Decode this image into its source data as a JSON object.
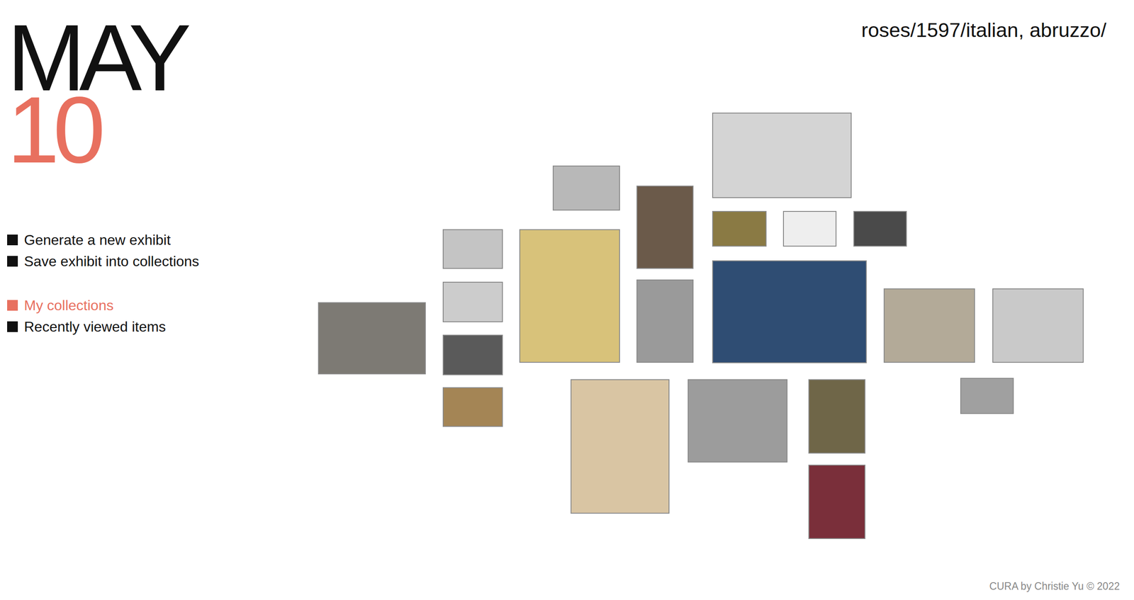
{
  "date": {
    "month": "MAY",
    "day": "10"
  },
  "menu": {
    "groups": [
      {
        "items": [
          {
            "label": "Generate a new exhibit",
            "selected": false
          },
          {
            "label": "Save exhibit into collections",
            "selected": false
          }
        ]
      },
      {
        "items": [
          {
            "label": "My collections",
            "selected": true
          },
          {
            "label": "Recently viewed items",
            "selected": false
          }
        ]
      }
    ]
  },
  "breadcrumb": "roses/1597/italian, abruzzo/",
  "footer": "CURA by Christie Yu © 2022"
}
